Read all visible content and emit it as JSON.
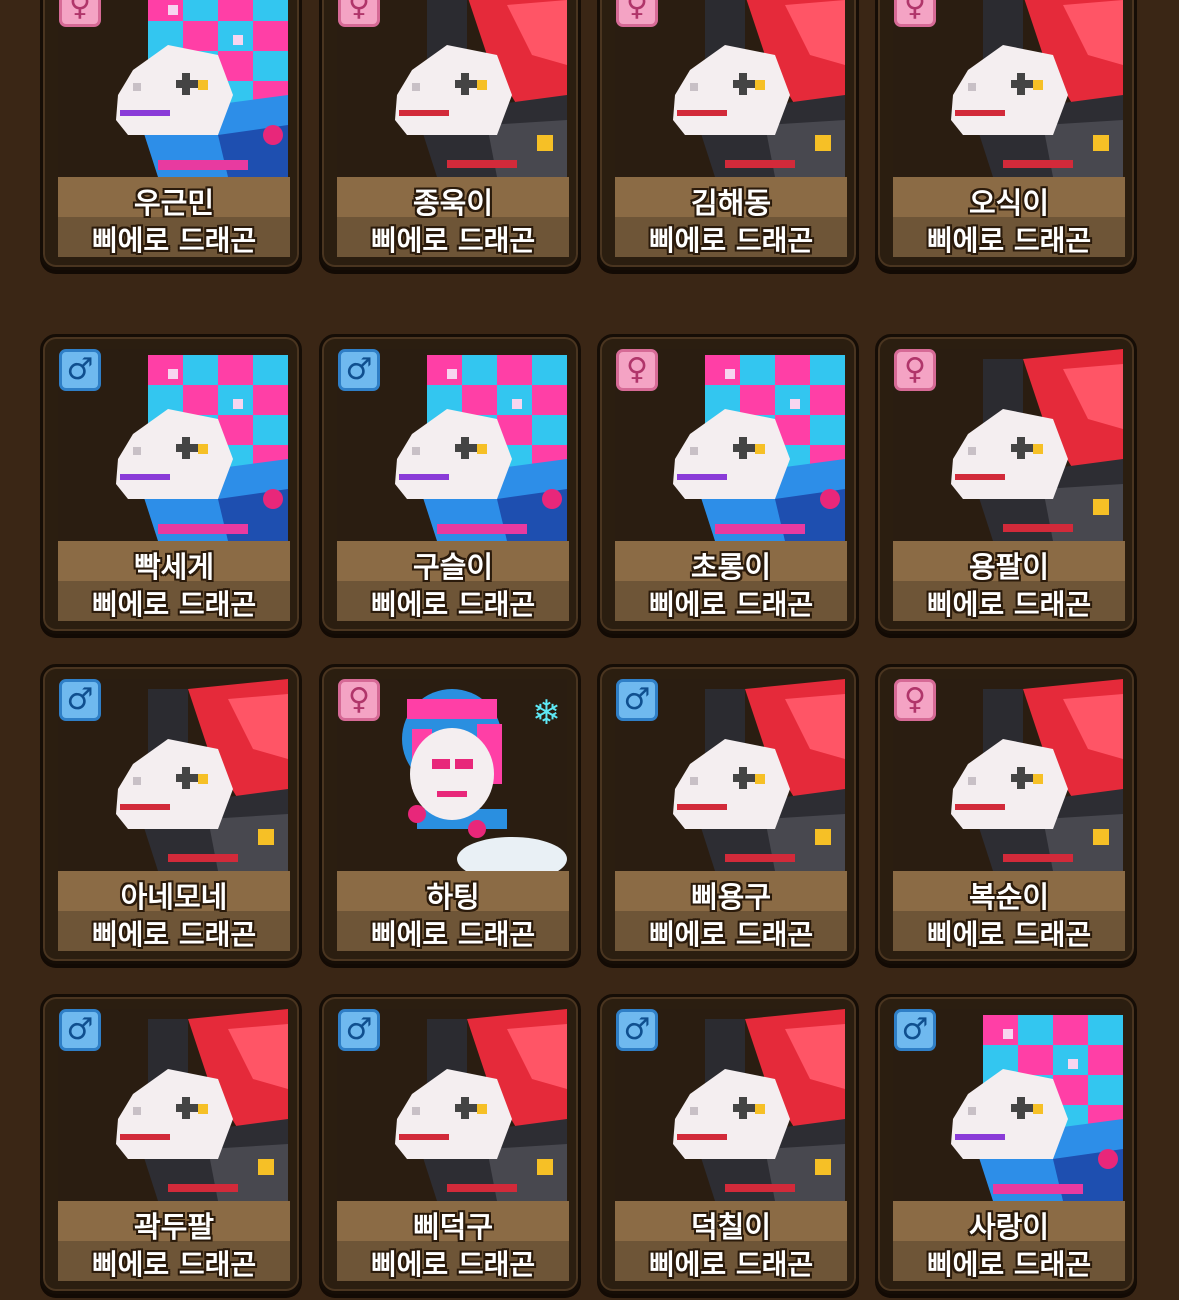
{
  "species_label": "삐에로 드래곤",
  "colors": {
    "background": "#3a2615",
    "card": "#2b1e10",
    "nameplate": "#8b6b45",
    "female_badge": "#f4a3c4",
    "male_badge": "#6fb9ef"
  },
  "dragons": [
    {
      "name": "우근민",
      "species": "삐에로 드래곤",
      "gender": "female",
      "gender_icon": "female-symbol-icon",
      "variant": "pastel"
    },
    {
      "name": "종욱이",
      "species": "삐에로 드래곤",
      "gender": "female",
      "gender_icon": "female-symbol-icon",
      "variant": "red"
    },
    {
      "name": "김해동",
      "species": "삐에로 드래곤",
      "gender": "female",
      "gender_icon": "female-symbol-icon",
      "variant": "red"
    },
    {
      "name": "오식이",
      "species": "삐에로 드래곤",
      "gender": "female",
      "gender_icon": "female-symbol-icon",
      "variant": "red"
    },
    {
      "name": "빡세게",
      "species": "삐에로 드래곤",
      "gender": "male",
      "gender_icon": "male-symbol-icon",
      "variant": "pastel"
    },
    {
      "name": "구슬이",
      "species": "삐에로 드래곤",
      "gender": "male",
      "gender_icon": "male-symbol-icon",
      "variant": "pastel"
    },
    {
      "name": "초롱이",
      "species": "삐에로 드래곤",
      "gender": "female",
      "gender_icon": "female-symbol-icon",
      "variant": "pastel"
    },
    {
      "name": "용팔이",
      "species": "삐에로 드래곤",
      "gender": "female",
      "gender_icon": "female-symbol-icon",
      "variant": "red"
    },
    {
      "name": "아네모네",
      "species": "삐에로 드래곤",
      "gender": "male",
      "gender_icon": "male-symbol-icon",
      "variant": "red"
    },
    {
      "name": "하팅",
      "species": "삐에로 드래곤",
      "gender": "female",
      "gender_icon": "female-symbol-icon",
      "variant": "baby"
    },
    {
      "name": "삐용구",
      "species": "삐에로 드래곤",
      "gender": "male",
      "gender_icon": "male-symbol-icon",
      "variant": "red"
    },
    {
      "name": "복순이",
      "species": "삐에로 드래곤",
      "gender": "female",
      "gender_icon": "female-symbol-icon",
      "variant": "red"
    },
    {
      "name": "곽두팔",
      "species": "삐에로 드래곤",
      "gender": "male",
      "gender_icon": "male-symbol-icon",
      "variant": "red"
    },
    {
      "name": "삐덕구",
      "species": "삐에로 드래곤",
      "gender": "male",
      "gender_icon": "male-symbol-icon",
      "variant": "red"
    },
    {
      "name": "덕칠이",
      "species": "삐에로 드래곤",
      "gender": "male",
      "gender_icon": "male-symbol-icon",
      "variant": "red"
    },
    {
      "name": "사랑이",
      "species": "삐에로 드래곤",
      "gender": "male",
      "gender_icon": "male-symbol-icon",
      "variant": "pastel"
    }
  ]
}
